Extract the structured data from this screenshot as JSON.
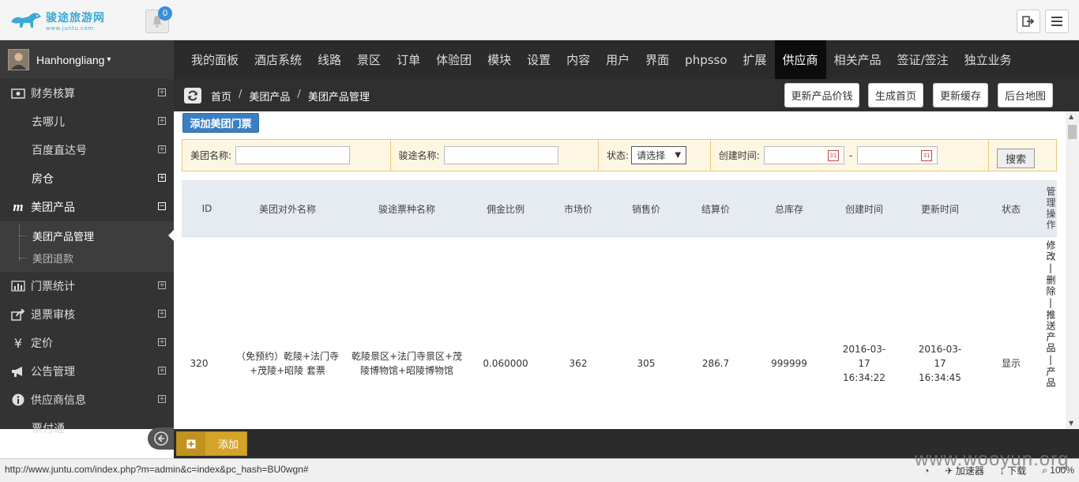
{
  "header": {
    "logo_text": "骏途旅游网",
    "logo_url": "www.juntu.com",
    "notification_count": "0"
  },
  "user": {
    "name": "Hanhongliang"
  },
  "nav": {
    "items": [
      "我的面板",
      "酒店系统",
      "线路",
      "景区",
      "订单",
      "体验团",
      "模块",
      "设置",
      "内容",
      "用户",
      "界面",
      "phpsso",
      "扩展",
      "供应商",
      "相关产品",
      "签证/签注",
      "独立业务"
    ],
    "active": "供应商"
  },
  "sidebar": {
    "items": [
      {
        "label": "财务核算",
        "icon": "money-icon",
        "toggle": "+"
      },
      {
        "label": "去哪儿",
        "icon": "",
        "toggle": "+"
      },
      {
        "label": "百度直达号",
        "icon": "",
        "toggle": "+"
      },
      {
        "label": "房仓",
        "icon": "",
        "toggle": "+"
      },
      {
        "label": "美团产品",
        "icon": "meituan-icon",
        "toggle": "−"
      }
    ],
    "sub_items": [
      "美团产品管理",
      "美团退款"
    ],
    "items_after": [
      {
        "label": "门票统计",
        "icon": "bar-chart-icon",
        "toggle": "+"
      },
      {
        "label": "退票审核",
        "icon": "share-icon",
        "toggle": "+"
      },
      {
        "label": "定价",
        "icon": "yen-icon",
        "toggle": "+"
      },
      {
        "label": "公告管理",
        "icon": "bullhorn-icon",
        "toggle": "+"
      },
      {
        "label": "供应商信息",
        "icon": "info-icon",
        "toggle": "+"
      },
      {
        "label": "票付通",
        "icon": "",
        "toggle": ""
      }
    ]
  },
  "breadcrumb": {
    "items": [
      "首页",
      "美团产品",
      "美团产品管理"
    ],
    "separator": "/"
  },
  "actions": [
    "更新产品价钱",
    "生成首页",
    "更新缓存",
    "后台地图"
  ],
  "content": {
    "add_button": "添加美团门票",
    "filter": {
      "meituan_name_label": "美团名称:",
      "juntu_name_label": "骏途名称:",
      "status_label": "状态:",
      "status_selected": "请选择",
      "created_label": "创建时间:",
      "range_sep": "-",
      "search_button": "搜索"
    },
    "columns": [
      "ID",
      "美团对外名称",
      "骏途票种名称",
      "佣金比例",
      "市场价",
      "销售价",
      "结算价",
      "总库存",
      "创建时间",
      "更新时间",
      "状态",
      "管理操作"
    ],
    "rows": [
      {
        "id": "320",
        "meituan_name": "（免预约）乾陵+法门寺+茂陵+昭陵 套票",
        "juntu_name": "乾陵景区+法门寺景区+茂陵博物馆+昭陵博物馆",
        "commission": "0.060000",
        "market_price": "362",
        "sale_price": "305",
        "settle_price": "286.7",
        "stock": "999999",
        "created": "2016-03-17 16:34:22",
        "updated": "2016-03-17 16:34:45",
        "status": "显示",
        "ops": "修改|删除|推送产品|产品"
      }
    ]
  },
  "bottombar": {
    "add_label": "添加"
  },
  "statusbar": {
    "url": "http://www.juntu.com/index.php?m=admin&c=index&pc_hash=BU0wgn#",
    "accelerator": "加速器",
    "download": "下载",
    "zoom": "100%"
  },
  "watermark": "www.wooyun.org"
}
